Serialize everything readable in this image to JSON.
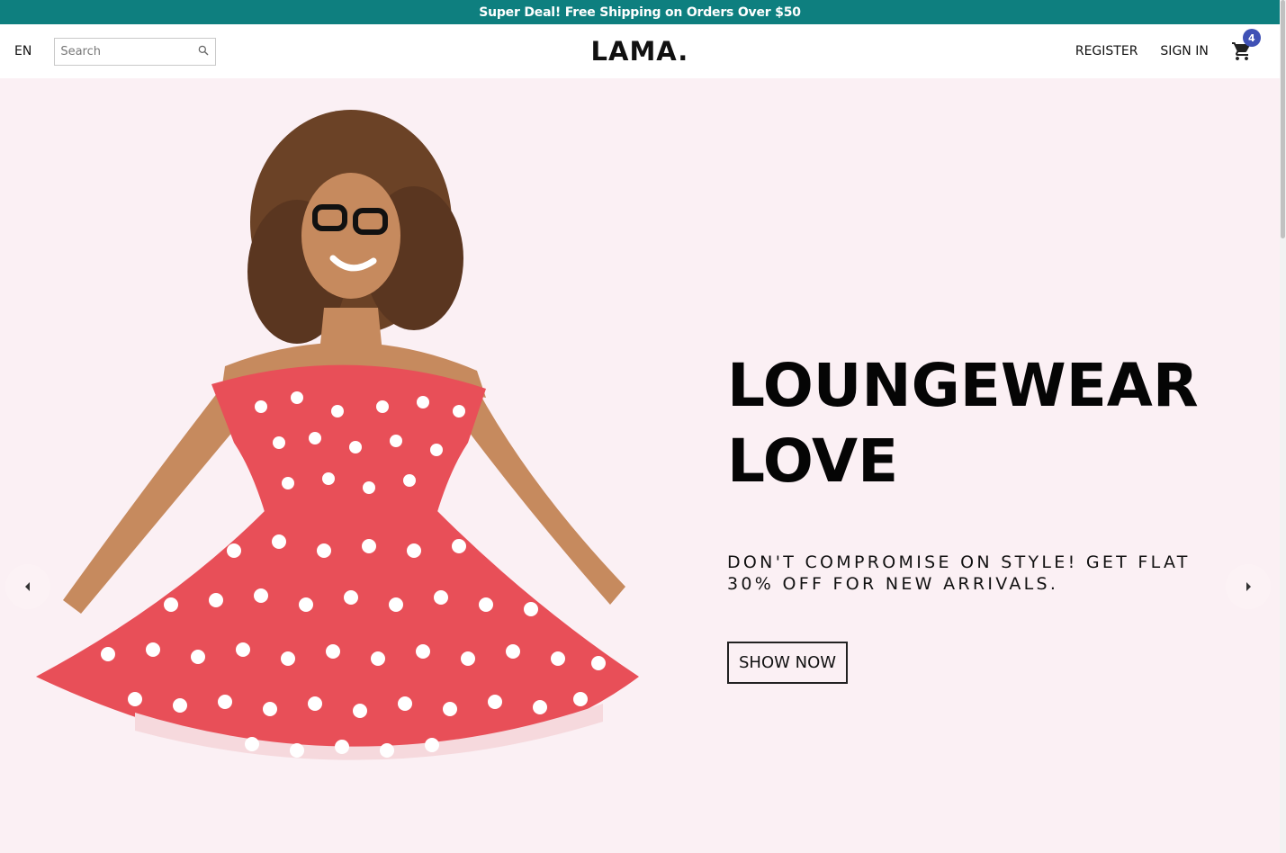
{
  "announcement": {
    "text": "Super Deal! Free Shipping on Orders Over $50",
    "bg_color": "#0e7f7f"
  },
  "navbar": {
    "language": "EN",
    "search": {
      "placeholder": "Search",
      "value": "",
      "icon": "search-icon"
    },
    "logo": "LAMA.",
    "links": {
      "register": "REGISTER",
      "sign_in": "SIGN IN"
    },
    "cart": {
      "icon": "shopping-cart-icon",
      "count": "4",
      "badge_color": "#3f51b5"
    }
  },
  "slider": {
    "bg_color": "#fbf0f4",
    "image": {
      "description_icon": "model-photo"
    },
    "title_line1": "LOUNGEWEAR",
    "title_line2": "LOVE",
    "description": "DON'T COMPROMISE ON STYLE! GET FLAT 30% OFF FOR NEW ARRIVALS.",
    "button_label": "SHOW NOW",
    "prev_icon": "arrow-left-icon",
    "next_icon": "arrow-right-icon"
  }
}
